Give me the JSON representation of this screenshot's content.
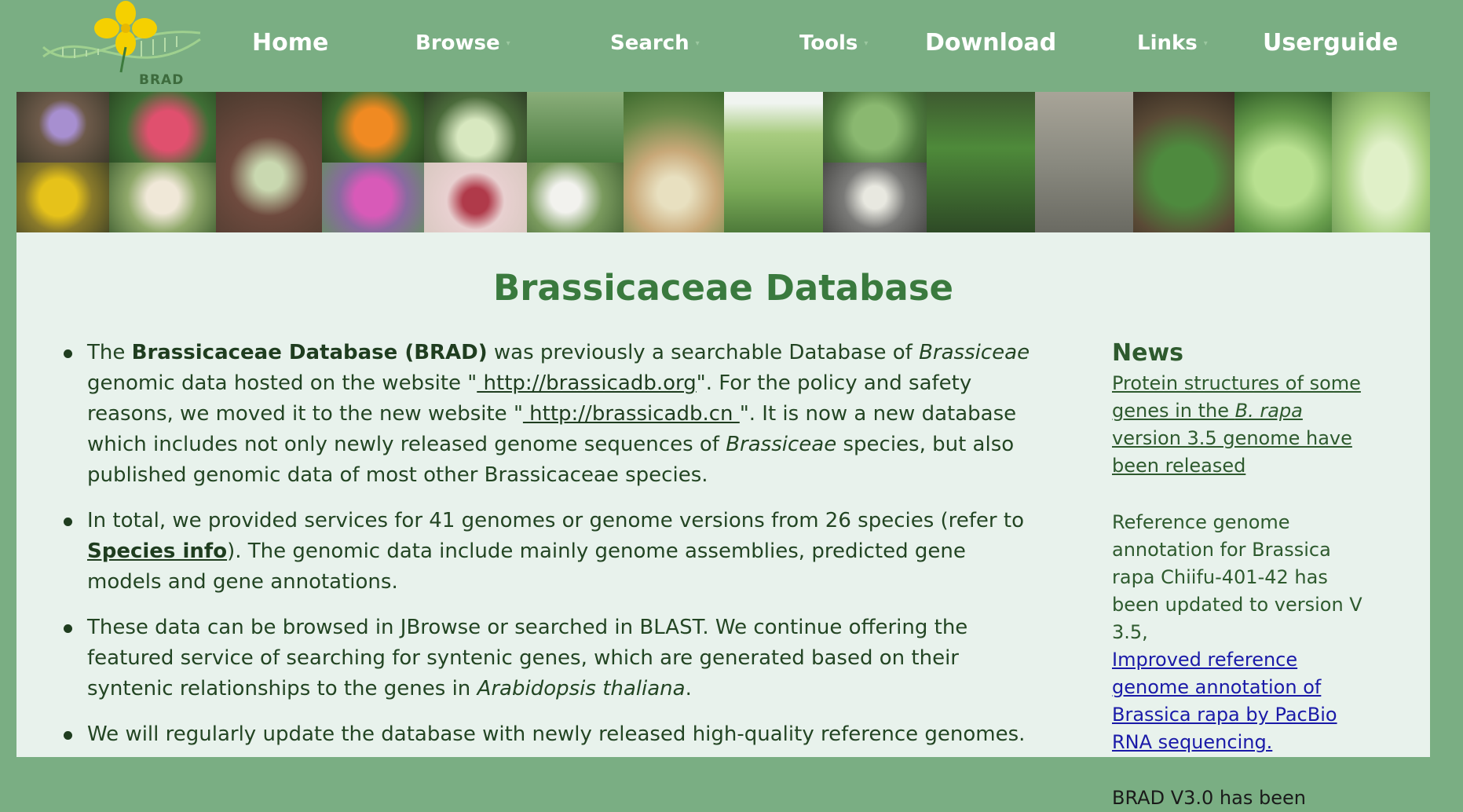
{
  "logo": {
    "text": "BRAD"
  },
  "nav": {
    "home": "Home",
    "browse": "Browse",
    "search": "Search",
    "tools": "Tools",
    "download": "Download",
    "links": "Links",
    "userguide": "Userguide"
  },
  "page": {
    "title": "Brassicaceae Database"
  },
  "intro": {
    "p1_a": "The ",
    "p1_bold": "Brassicaceae Database (BRAD)",
    "p1_b": " was previously a searchable Database of ",
    "p1_italic1": "Brassiceae",
    "p1_c": " genomic data hosted on the website \"",
    "p1_link1": " http://brassicadb.org",
    "p1_d": "\". For the policy and safety reasons, we moved it to the new website \"",
    "p1_link2": " http://brassicadb.cn ",
    "p1_e": "\". It is now a new database which includes not only newly released genome sequences of ",
    "p1_italic2": "Brassiceae",
    "p1_f": " species, but also published genomic data of most other Brassicaceae species.",
    "p2_a": "In total, we provided services for 41 genomes or genome versions from 26 species (refer to ",
    "p2_link": "Species info",
    "p2_b": "). The genomic data include mainly genome assemblies, predicted gene models and gene annotations.",
    "p3_a": "These data can be browsed in JBrowse or searched in BLAST. We continue offering the featured service of searching for syntenic genes, which are generated based on their syntenic relationships to the genes in ",
    "p3_italic": "Arabidopsis thaliana",
    "p3_b": ".",
    "p4": "We will regularly update the database with newly released high-quality reference genomes."
  },
  "news": {
    "title": "News",
    "item1_a": "Protein structures of some genes in the ",
    "item1_italic": "B. rapa",
    "item1_b": " version 3.5 genome have been released",
    "item2_text": "Reference genome annotation for Brassica rapa Chiifu-401-42 has been updated to version V 3.5,",
    "item2_link": "Improved reference genome annotation of Brassica rapa by PacBio RNA sequencing.",
    "item3_text": "BRAD V3.0 has been"
  },
  "colors": {
    "background": "#7aae83",
    "content_bg": "#e8f2ec",
    "title_green": "#3a7a3e",
    "link_blue": "#1a1aa8",
    "logo_yellow": "#f5d000"
  }
}
